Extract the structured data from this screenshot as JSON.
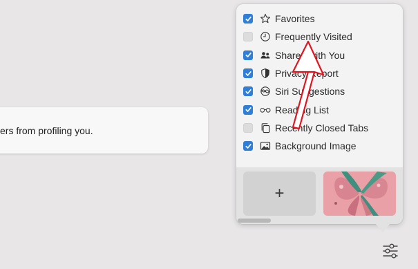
{
  "background_card": {
    "text": "ers from profiling you."
  },
  "popover": {
    "items": [
      {
        "label": "Favorites",
        "checked": true,
        "icon": "star-icon"
      },
      {
        "label": "Frequently Visited",
        "checked": false,
        "icon": "clock-icon"
      },
      {
        "label": "Shared with You",
        "checked": true,
        "icon": "people-icon"
      },
      {
        "label": "Privacy Report",
        "checked": true,
        "icon": "shield-icon"
      },
      {
        "label": "Siri Suggestions",
        "checked": true,
        "icon": "siri-icon"
      },
      {
        "label": "Reading List",
        "checked": true,
        "icon": "glasses-icon"
      },
      {
        "label": "Recently Closed Tabs",
        "checked": false,
        "icon": "tabs-icon"
      },
      {
        "label": "Background Image",
        "checked": true,
        "icon": "image-icon"
      }
    ],
    "add_button_label": "+",
    "background_thumbnail": "butterfly-image"
  },
  "colors": {
    "checkbox_on": "#2f7ed8",
    "annotation_arrow": "#e0151f",
    "thumbnail_pink": "#e9a0a7",
    "thumbnail_green": "#3f8f7e"
  },
  "settings_button": {
    "icon": "sliders-icon"
  }
}
